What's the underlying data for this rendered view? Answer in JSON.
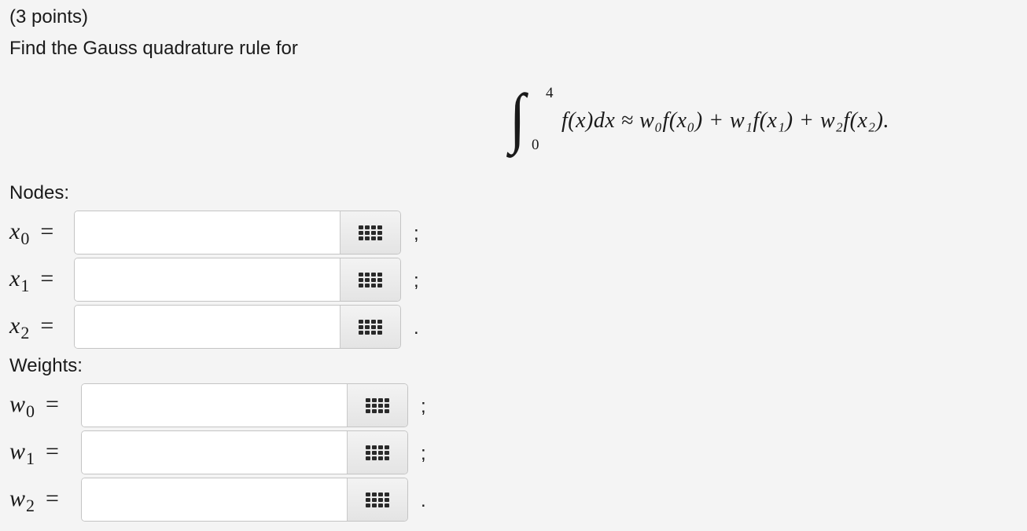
{
  "question": {
    "points": "(3 points)",
    "prompt": "Find the Gauss quadrature rule for"
  },
  "formula": {
    "integral_sign": "∫",
    "upper_limit": "4",
    "lower_limit": "0",
    "integrand": "f(x)dx ≈ w₀f(x₀) + w₁f(x₁) + w₂f(x₂)."
  },
  "nodes": {
    "label": "Nodes:",
    "fields": [
      {
        "var": "x",
        "sub": "0",
        "eq": "=",
        "value": "",
        "punct": ";"
      },
      {
        "var": "x",
        "sub": "1",
        "eq": "=",
        "value": "",
        "punct": ";"
      },
      {
        "var": "x",
        "sub": "2",
        "eq": "=",
        "value": "",
        "punct": "."
      }
    ]
  },
  "weights": {
    "label": "Weights:",
    "fields": [
      {
        "var": "w",
        "sub": "0",
        "eq": "=",
        "value": "",
        "punct": ";"
      },
      {
        "var": "w",
        "sub": "1",
        "eq": "=",
        "value": "",
        "punct": ";"
      },
      {
        "var": "w",
        "sub": "2",
        "eq": "=",
        "value": "",
        "punct": "."
      }
    ]
  },
  "icons": {
    "matrix_button": "grid-icon"
  },
  "colors": {
    "background": "#f4f4f4",
    "field_border": "#c4c4c4",
    "button_bg": "#e9e9e9"
  }
}
